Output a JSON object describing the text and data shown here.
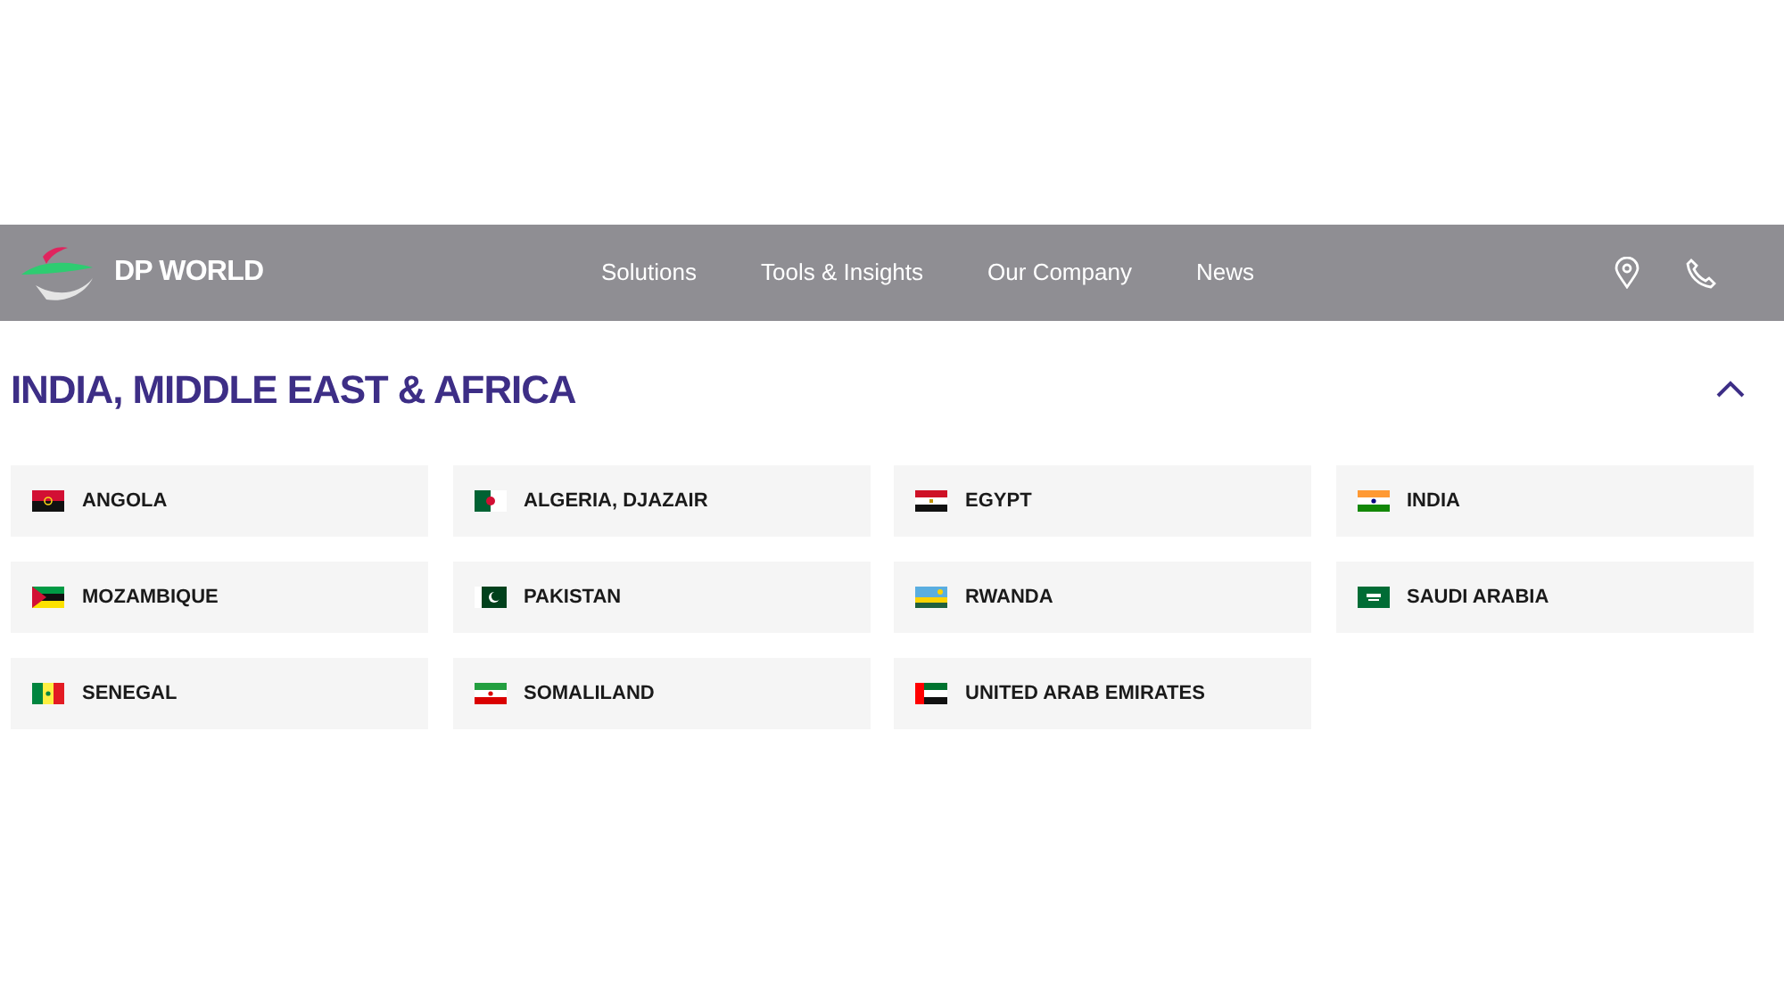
{
  "header": {
    "logo_text": "DP WORLD",
    "nav": [
      "Solutions",
      "Tools & Insights",
      "Our Company",
      "News"
    ]
  },
  "region": {
    "title": "INDIA, MIDDLE EAST & AFRICA",
    "expanded": true,
    "countries": [
      "ANGOLA",
      "ALGERIA, DJAZAIR",
      "EGYPT",
      "INDIA",
      "MOZAMBIQUE",
      "PAKISTAN",
      "RWANDA",
      "SAUDI ARABIA",
      "SENEGAL",
      "SOMALILAND",
      "UNITED ARAB EMIRATES"
    ]
  }
}
